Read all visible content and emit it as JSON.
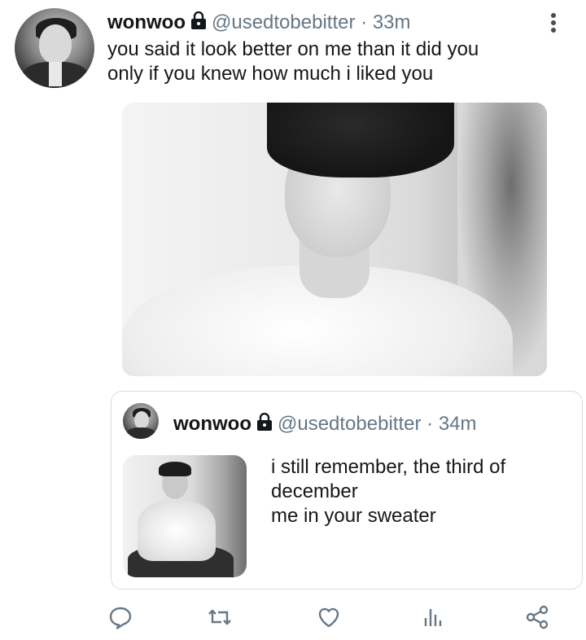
{
  "tweet": {
    "name": "wonwoo",
    "handle": "@usedtobebitter",
    "separator": "·",
    "time": "33m",
    "text_lines": [
      "you said it look better on me than it did you",
      "only if you knew how much i liked you"
    ],
    "icons": {
      "protected": "lock-icon",
      "menu": "more-vertical-icon"
    }
  },
  "quoted": {
    "name": "wonwoo",
    "handle": "@usedtobebitter",
    "separator": "·",
    "time": "34m",
    "text_lines": [
      "i still remember, the third of",
      "december",
      "me in your sweater"
    ]
  },
  "actions": [
    {
      "name": "reply",
      "icon": "reply-icon"
    },
    {
      "name": "retweet",
      "icon": "retweet-icon"
    },
    {
      "name": "like",
      "icon": "heart-icon"
    },
    {
      "name": "analytics",
      "icon": "analytics-icon"
    },
    {
      "name": "share",
      "icon": "share-icon"
    }
  ],
  "colors": {
    "text": "#14171a",
    "secondary": "#657786",
    "border": "#d6dde3"
  }
}
